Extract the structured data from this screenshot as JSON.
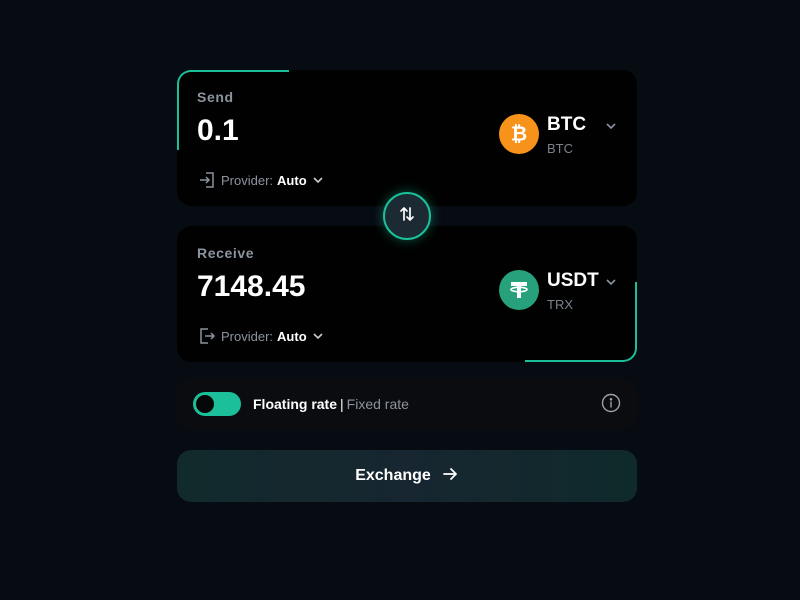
{
  "send": {
    "label": "Send",
    "amount": "0.1",
    "provider_label": "Provider:",
    "provider_value": "Auto",
    "coin_symbol": "BTC",
    "coin_network": "BTC",
    "coin_icon": "bitcoin-icon"
  },
  "receive": {
    "label": "Receive",
    "amount": "7148.45",
    "provider_label": "Provider:",
    "provider_value": "Auto",
    "coin_symbol": "USDT",
    "coin_network": "TRX",
    "coin_icon": "tether-icon"
  },
  "rate": {
    "floating_label": "Floating rate",
    "separator": "|",
    "fixed_label": "Fixed rate",
    "mode": "floating"
  },
  "exchange_button": {
    "label": "Exchange"
  },
  "colors": {
    "accent": "#1bbf99",
    "background": "#070b12",
    "bitcoin": "#f7931a",
    "tether": "#26a17b"
  }
}
